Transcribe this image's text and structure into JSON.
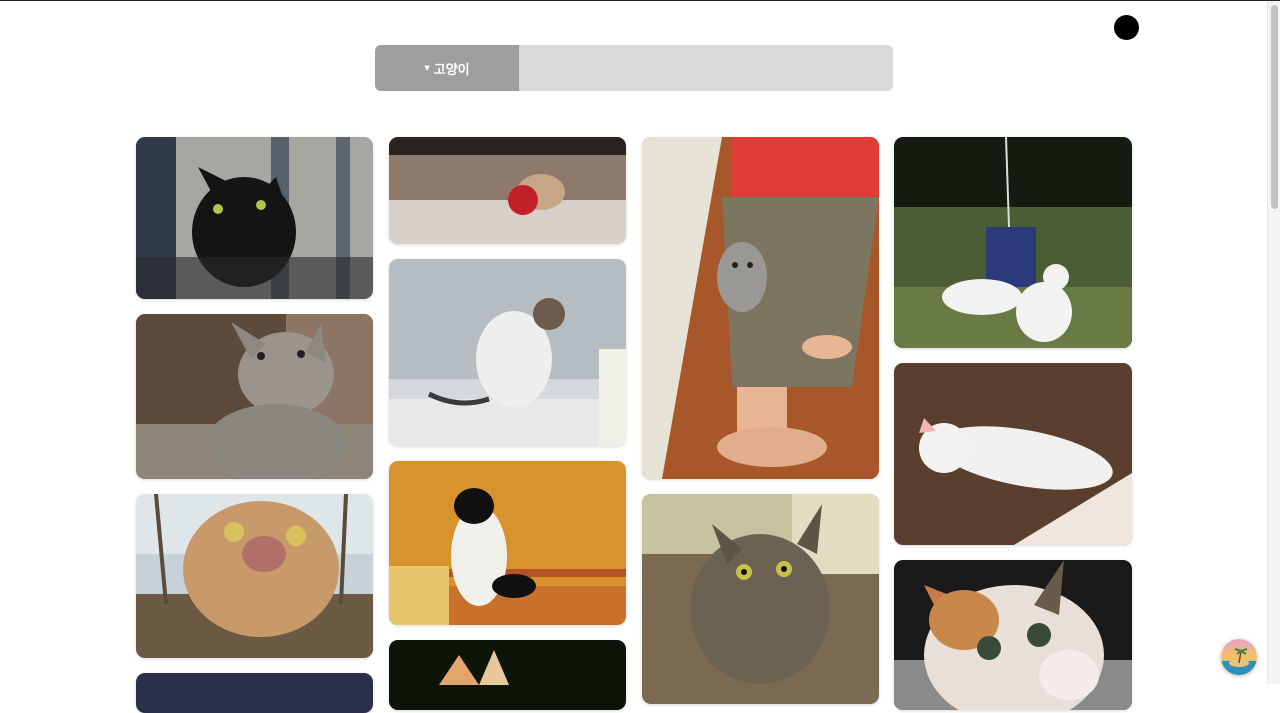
{
  "search": {
    "category_label": "고양이",
    "query": "",
    "placeholder": ""
  },
  "gallery": {
    "subject": "고양이"
  },
  "icons": {
    "toggle": "dark-circle-toggle",
    "caret": "caret-down-icon",
    "fab": "island-sunset-avatar"
  },
  "colors": {
    "search_bar_bg": "#d9d9d9",
    "search_select_bg": "#9e9e9e",
    "toggle": "#000000"
  }
}
